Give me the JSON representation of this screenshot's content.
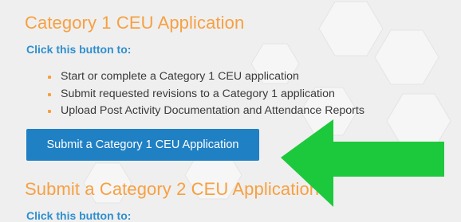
{
  "section1": {
    "title": "Category 1 CEU Application",
    "subtitle": "Click this button to:",
    "bullets": [
      "Start or complete a Category 1 CEU application",
      "Submit requested revisions to a Category 1 application",
      "Upload Post Activity Documentation and Attendance Reports"
    ],
    "button_label": "Submit a Category 1 CEU Application"
  },
  "section2": {
    "title": "Submit a Category 2 CEU Application",
    "subtitle": "Click this button to:"
  },
  "colors": {
    "heading": "#f7a041",
    "subheading": "#2f8fce",
    "button": "#1f80c4",
    "arrow": "#1dc93c",
    "background": "#efefef"
  },
  "icons": {
    "annotation_arrow": "green-arrow-icon"
  }
}
